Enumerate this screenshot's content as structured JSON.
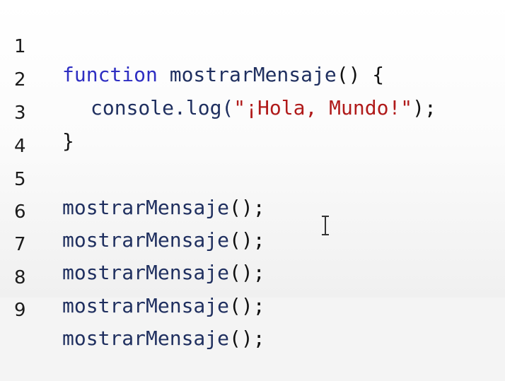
{
  "editor": {
    "lines": [
      {
        "number": "1",
        "tokens": {
          "kw": "function",
          "fn": "mostrarMensaje",
          "punc": "() {"
        }
      },
      {
        "number": "2",
        "tokens": {
          "obj": "console.log(",
          "str": "\"¡Hola, Mundo!\"",
          "punc": ");"
        }
      },
      {
        "number": "3",
        "tokens": {
          "punc": "}"
        }
      },
      {
        "number": "4",
        "tokens": {}
      },
      {
        "number": "5",
        "tokens": {
          "fn": "mostrarMensaje",
          "punc": "();"
        }
      },
      {
        "number": "6",
        "tokens": {
          "fn": "mostrarMensaje",
          "punc": "();"
        }
      },
      {
        "number": "7",
        "tokens": {
          "fn": "mostrarMensaje",
          "punc": "();"
        }
      },
      {
        "number": "8",
        "tokens": {
          "fn": "mostrarMensaje",
          "punc": "();"
        }
      },
      {
        "number": "9",
        "tokens": {
          "fn": "mostrarMensaje",
          "punc": "();"
        }
      }
    ],
    "cursor_icon": "text-cursor-icon"
  },
  "colors": {
    "keyword": "#2e2ec2",
    "string": "#b01a1a",
    "identifier": "#1f2f5f",
    "background": "#ffffff"
  }
}
